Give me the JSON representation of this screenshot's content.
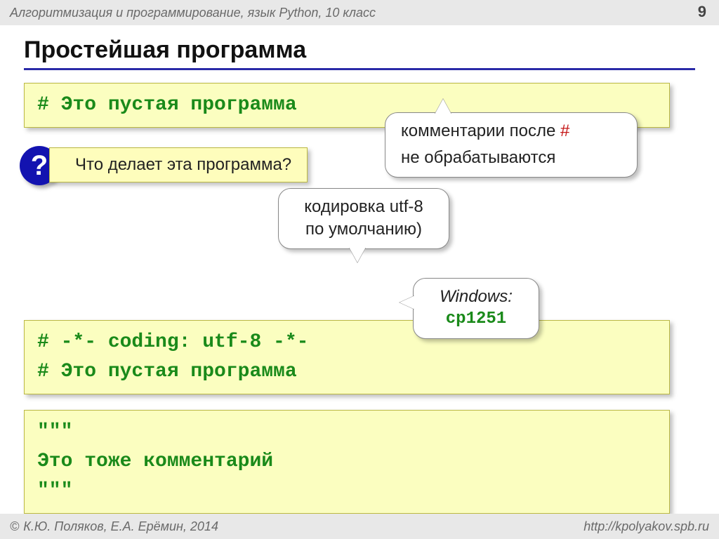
{
  "header": {
    "breadcrumb": "Алгоритмизация и программирование, язык Python, 10 класс",
    "page_number": "9"
  },
  "title": "Простейшая программа",
  "code_box_1": "# Это пустая программа",
  "question": {
    "badge": "?",
    "text": "Что делает эта программа?"
  },
  "speech_comments": {
    "prefix": "комментарии после ",
    "hash": "#",
    "suffix": "не обрабатываются"
  },
  "speech_encoding": {
    "line1": "кодировка utf-8",
    "line2": "по умолчанию)"
  },
  "code_box_2_line1": "# -*- coding: utf-8 -*-",
  "code_box_2_line2": "# Это пустая программа",
  "speech_windows": {
    "line1": "Windows:",
    "line2": "cp1251"
  },
  "code_box_3_line1": "\"\"\"",
  "code_box_3_line2": "Это тоже комментарий",
  "code_box_3_line3": "\"\"\"",
  "footer": {
    "copyright": "К.Ю. Поляков, Е.А. Ерёмин, 2014",
    "url": "http://kpolyakov.spb.ru"
  }
}
